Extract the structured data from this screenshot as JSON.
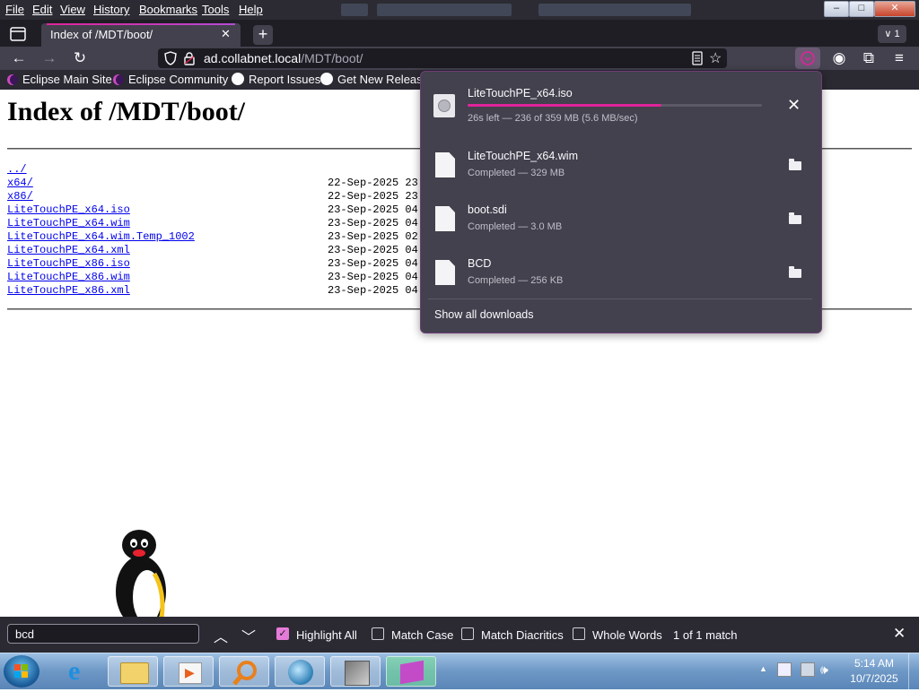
{
  "menubar": {
    "items": [
      "File",
      "Edit",
      "View",
      "History",
      "Bookmarks",
      "Tools",
      "Help"
    ]
  },
  "window": {
    "minimize": "–",
    "maximize": "□",
    "close": "✕"
  },
  "tab": {
    "title": "Index of /MDT/boot/",
    "close": "✕",
    "new_tab": "+",
    "list_all": "∨ 1"
  },
  "navbar": {
    "url_host": "ad.collabnet.local",
    "url_path": "/MDT/boot/"
  },
  "bookmarks": [
    {
      "label": "Eclipse Main Site",
      "icon": "eclipse-icon"
    },
    {
      "label": "Eclipse Community",
      "icon": "eclipse-icon"
    },
    {
      "label": "Report Issues",
      "icon": "github-icon"
    },
    {
      "label": "Get New Releases",
      "icon": "github-icon"
    }
  ],
  "page": {
    "heading": "Index of /MDT/boot/",
    "entries": [
      {
        "name": "../",
        "date": ""
      },
      {
        "name": "x64/",
        "date": "22-Sep-2025 23:"
      },
      {
        "name": "x86/",
        "date": "22-Sep-2025 23:"
      },
      {
        "name": "LiteTouchPE_x64.iso",
        "date": "23-Sep-2025 04:"
      },
      {
        "name": "LiteTouchPE_x64.wim",
        "date": "23-Sep-2025 04:"
      },
      {
        "name": "LiteTouchPE_x64.wim.Temp_1002",
        "date": "23-Sep-2025 02:"
      },
      {
        "name": "LiteTouchPE_x64.xml",
        "date": "23-Sep-2025 04:"
      },
      {
        "name": "LiteTouchPE_x86.iso",
        "date": "23-Sep-2025 04:"
      },
      {
        "name": "LiteTouchPE_x86.wim",
        "date": "23-Sep-2025 04:"
      },
      {
        "name": "LiteTouchPE_x86.xml",
        "date": "23-Sep-2025 04:"
      }
    ]
  },
  "downloads": {
    "items": [
      {
        "name": "LiteTouchPE_x64.iso",
        "status": "26s left — 236 of 359 MB (5.6 MB/sec)",
        "progress": 0.66,
        "in_progress": true
      },
      {
        "name": "LiteTouchPE_x64.wim",
        "status": "Completed — 329 MB"
      },
      {
        "name": "boot.sdi",
        "status": "Completed — 3.0 MB"
      },
      {
        "name": "BCD",
        "status": "Completed — 256 KB"
      }
    ],
    "show_all": "Show all downloads",
    "accent": "#e0249a"
  },
  "findbar": {
    "query": "bcd",
    "highlight_all": "Highlight All",
    "highlight_all_checked": true,
    "match_case": "Match Case",
    "match_diacritics": "Match Diacritics",
    "whole_words": "Whole Words",
    "result": "1 of 1 match"
  },
  "taskbar": {
    "time": "5:14 AM",
    "date": "10/7/2025",
    "apps": [
      "internet-explorer-icon",
      "file-explorer-icon",
      "media-player-icon",
      "search-magnifier-icon",
      "network-globe-icon",
      "app-icon",
      "app-icon"
    ]
  }
}
